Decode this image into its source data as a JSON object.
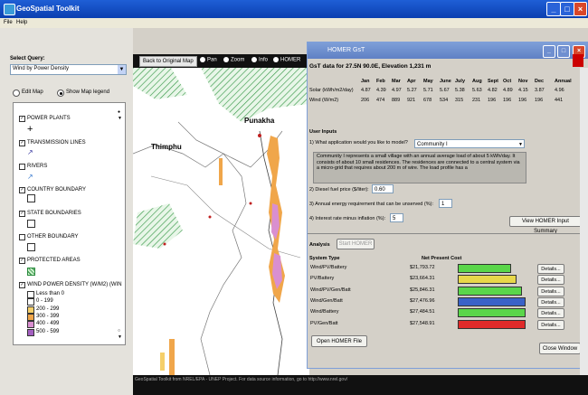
{
  "window": {
    "title": "GeoSpatial Toolkit"
  },
  "menu": [
    "File",
    "Help"
  ],
  "left_panel": {
    "select_query_label": "Select Query:",
    "query_value": "Wind by Power Density",
    "edit_map_label": "Edit Map",
    "show_legend_label": "Show Map legend",
    "layers": [
      {
        "name": "POWER PLANTS",
        "checked": true
      },
      {
        "name": "TRANSMISSION LINES",
        "checked": true
      },
      {
        "name": "RIVERS",
        "checked": false
      },
      {
        "name": "COUNTRY BOUNDARY",
        "checked": true
      },
      {
        "name": "STATE BOUNDARIES",
        "checked": true
      },
      {
        "name": "OTHER BOUNDARY",
        "checked": false
      },
      {
        "name": "PROTECTED AREAS",
        "checked": true
      },
      {
        "name": "WIND POWER DENSITY (W/M2) (WIN",
        "checked": true
      }
    ],
    "wind_classes": [
      {
        "label": "Less than 0",
        "color": "#ffffff"
      },
      {
        "label": "0 - 199",
        "color": "#ffffff"
      },
      {
        "label": "200 - 299",
        "color": "#f5cf6a"
      },
      {
        "label": "300 - 399",
        "color": "#f0a64a"
      },
      {
        "label": "400 - 499",
        "color": "#d98fd0"
      },
      {
        "label": "500 - 599",
        "color": "#a35fc0"
      }
    ]
  },
  "map_toolbar": {
    "back_button": "Back to Original Map",
    "tools": [
      "Pan",
      "Zoom",
      "Info",
      "HOMER"
    ]
  },
  "map": {
    "labels": [
      "Punakha",
      "Thimphu"
    ]
  },
  "status_bar": {
    "text": "GeoSpatial Toolkit from NREL/EPA - UNEP Project. For data source information, go to http://www.nrel.gov/"
  },
  "homer": {
    "title": "HOMER GsT",
    "data_header": "GsT data for 27.5N 90.0E, Elevation 1,231 m",
    "months": [
      "Jan",
      "Feb",
      "Mar",
      "Apr",
      "May",
      "June",
      "July",
      "Aug",
      "Sept",
      "Oct",
      "Nov",
      "Dec",
      "Annual"
    ],
    "rows": [
      {
        "label": "Solar (kWh/m2/day)",
        "values": [
          "4.87",
          "4.39",
          "4.97",
          "5.27",
          "5.71",
          "5.67",
          "5.38",
          "5.63",
          "4.82",
          "4.89",
          "4.15",
          "3.87",
          "4.96"
        ]
      },
      {
        "label": "Wind (W/m2)",
        "values": [
          "206",
          "474",
          "889",
          "921",
          "678",
          "534",
          "315",
          "231",
          "196",
          "196",
          "196",
          "196",
          "441"
        ]
      }
    ],
    "user_inputs_title": "User Inputs",
    "q1": "1) What application would you like to model?",
    "q1_value": "Community I",
    "description": "Community I represents a small village with an annual average load of about 5 kWh/day. It consists of about 10 small residences. The residences are connected to a central system via a micro-grid that requires about 200 m of wire. The load profile has a",
    "q2": "2) Diesel fuel price ($/liter):",
    "q2_value": "0.60",
    "q3": "3) Annual energy requirement that can be unserved (%):",
    "q3_value": "1",
    "q4": "4) Interest rate minus inflation (%):",
    "q4_value": "5",
    "view_summary_button": "View HOMER Input Summary",
    "analysis_label": "Analysis",
    "start_homer_button": "Start HOMER",
    "col_system": "System Type",
    "col_npc": "Net Present Cost",
    "results": [
      {
        "system": "Wind/PV/Battery",
        "cost": "$21,793.72",
        "ratio": 0.79,
        "color": "#5ad64a"
      },
      {
        "system": "PV/Battery",
        "cost": "$23,664.31",
        "ratio": 0.86,
        "color": "#e8d84a"
      },
      {
        "system": "Wind/PV/Gen/Batt",
        "cost": "$25,846.31",
        "ratio": 0.94,
        "color": "#5ad64a"
      },
      {
        "system": "Wind/Gen/Batt",
        "cost": "$27,476.96",
        "ratio": 1.0,
        "color": "#3a62c8"
      },
      {
        "system": "Wind/Battery",
        "cost": "$27,484.51",
        "ratio": 1.0,
        "color": "#5ad64a"
      },
      {
        "system": "PV/Gen/Batt",
        "cost": "$27,548.91",
        "ratio": 1.0,
        "color": "#e02a2a"
      }
    ],
    "details_label": "Details...",
    "open_homer_button": "Open HOMER File",
    "close_button": "Close Window"
  }
}
